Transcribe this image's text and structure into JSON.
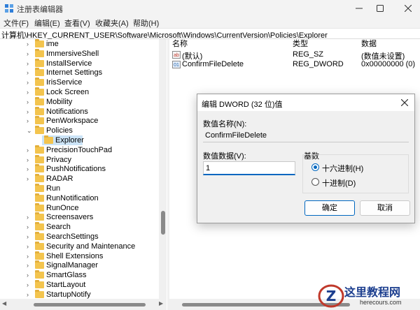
{
  "window": {
    "title": "注册表编辑器"
  },
  "menu": [
    {
      "label": "文件(F)"
    },
    {
      "label": "编辑(E)"
    },
    {
      "label": "查看(V)"
    },
    {
      "label": "收藏夹(A)"
    },
    {
      "label": "帮助(H)"
    }
  ],
  "address": {
    "path": "计算机\\HKEY_CURRENT_USER\\Software\\Microsoft\\Windows\\CurrentVersion\\Policies\\Explorer"
  },
  "tree": {
    "items": [
      {
        "label": "ime"
      },
      {
        "label": "ImmersiveShell"
      },
      {
        "label": "InstallService"
      },
      {
        "label": "Internet Settings"
      },
      {
        "label": "IrisService"
      },
      {
        "label": "Lock Screen"
      },
      {
        "label": "Mobility"
      },
      {
        "label": "Notifications"
      },
      {
        "label": "PenWorkspace"
      },
      {
        "label": "Policies"
      },
      {
        "label": "Explorer"
      },
      {
        "label": "PrecisionTouchPad"
      },
      {
        "label": "Privacy"
      },
      {
        "label": "PushNotifications"
      },
      {
        "label": "RADAR"
      },
      {
        "label": "Run"
      },
      {
        "label": "RunNotification"
      },
      {
        "label": "RunOnce"
      },
      {
        "label": "Screensavers"
      },
      {
        "label": "Search"
      },
      {
        "label": "SearchSettings"
      },
      {
        "label": "Security and Maintenance"
      },
      {
        "label": "Shell Extensions"
      },
      {
        "label": "SignalManager"
      },
      {
        "label": "SmartGlass"
      },
      {
        "label": "StartLayout"
      },
      {
        "label": "StartupNotify"
      }
    ]
  },
  "list": {
    "columns": {
      "name": "名称",
      "type": "类型",
      "data": "数据"
    },
    "rows": [
      {
        "name": "(默认)",
        "type": "REG_SZ",
        "data": "(数值未设置)",
        "icon": "string-value-icon",
        "icon_text": "ab"
      },
      {
        "name": "ConfirmFileDelete",
        "type": "REG_DWORD",
        "data": "0x00000000 (0)",
        "icon": "binary-value-icon",
        "icon_text": "01"
      }
    ]
  },
  "dialog": {
    "title": "编辑 DWORD (32 位)值",
    "name_label": "数值名称(N):",
    "name_value": "ConfirmFileDelete",
    "data_label": "数值数据(V):",
    "data_value": "1",
    "base_label": "基数",
    "radio_hex": "十六进制(H)",
    "radio_dec": "十进制(D)",
    "selected_base": "hex",
    "ok_label": "确定",
    "cancel_label": "取消"
  },
  "watermark": {
    "title": "这里教程网",
    "url": "herecours.com"
  },
  "colors": {
    "accent": "#0067c0",
    "selection": "#cce4f7",
    "folder": "#f3c44e"
  }
}
